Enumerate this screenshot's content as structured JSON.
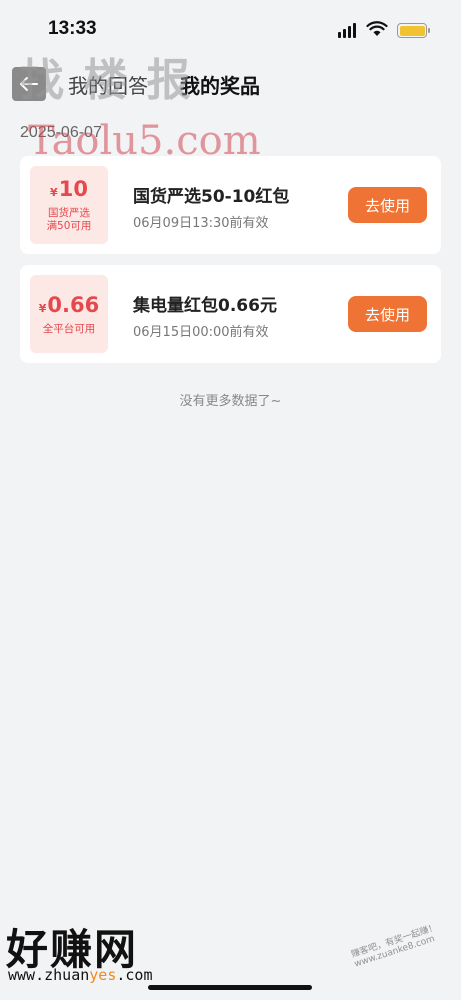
{
  "status_bar": {
    "time": "13:33"
  },
  "header": {
    "back_icon": "arrow-left-icon",
    "tabs": [
      {
        "label": "我的回答",
        "active": false
      },
      {
        "label": "我的奖品",
        "active": true
      }
    ]
  },
  "date_label": "2025-06-07",
  "coupons": [
    {
      "currency": "¥",
      "amount": "10",
      "condition_line1": "国货严选",
      "condition_line2": "满50可用",
      "title": "国货严选50-10红包",
      "expiry": "06月09日13:30前有效",
      "action_label": "去使用"
    },
    {
      "currency": "¥",
      "amount": "0.66",
      "condition_line1": "全平台可用",
      "condition_line2": "",
      "title": "集电量红包0.66元",
      "expiry": "06月15日00:00前有效",
      "action_label": "去使用"
    }
  ],
  "footer_note": "没有更多数据了~",
  "watermarks": {
    "top": "找 楼 报",
    "taolu": "Taolu5.com",
    "bottom": "好赚网",
    "url_prefix": "www.zhuan",
    "url_highlight": "yes",
    "url_suffix": ".com",
    "right": "赚客吧，有奖一起赚！ www.zuanke8.com"
  },
  "colors": {
    "accent": "#ee7334",
    "badge_text": "#e5484d",
    "badge_bg": "#fce9e6",
    "page_bg": "#f2f3f5"
  }
}
